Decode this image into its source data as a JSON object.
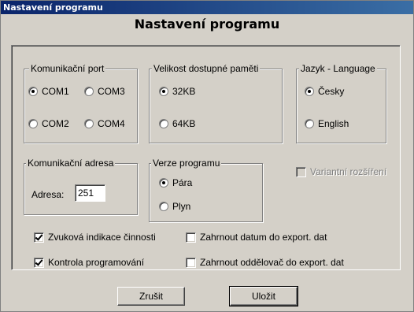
{
  "window": {
    "title": "Nastavení programu"
  },
  "heading": "Nastavení programu",
  "port_group": {
    "legend": "Komunikační port",
    "options": [
      "COM1",
      "COM3",
      "COM2",
      "COM4"
    ],
    "selected": "COM1"
  },
  "memory_group": {
    "legend": "Velikost dostupné paměti",
    "options": [
      "32KB",
      "64KB"
    ],
    "selected": "32KB"
  },
  "language_group": {
    "legend": "Jazyk - Language",
    "options": [
      "Česky",
      "English"
    ],
    "selected": "Česky"
  },
  "address_group": {
    "legend": "Komunikační adresa",
    "label": "Adresa:",
    "value": "251"
  },
  "version_group": {
    "legend": "Verze programu",
    "options": [
      "Pára",
      "Plyn"
    ],
    "selected": "Pára"
  },
  "variant_extension": {
    "label": "Variantní rozšíření",
    "checked": false,
    "enabled": false
  },
  "checkboxes": {
    "sound": {
      "label": "Zvuková indikace činnosti",
      "checked": true
    },
    "program_check": {
      "label": "Kontrola programování",
      "checked": true
    },
    "include_date": {
      "label": "Zahrnout datum do export. dat",
      "checked": false
    },
    "include_separator": {
      "label": "Zahrnout oddělovač do export. dat",
      "checked": false
    }
  },
  "buttons": {
    "cancel": "Zrušit",
    "save": "Uložit"
  }
}
